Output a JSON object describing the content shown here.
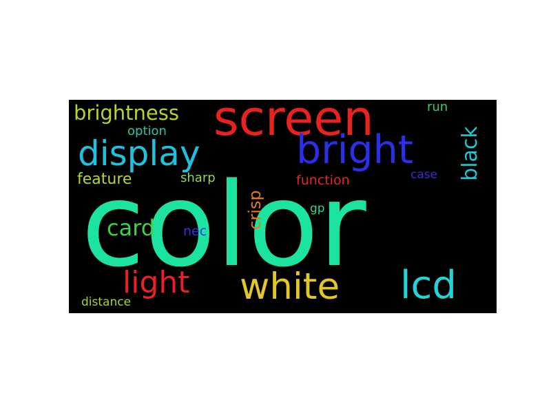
{
  "words": [
    {
      "text": "color",
      "color": "#1ce4a0"
    },
    {
      "text": "screen",
      "color": "#e8221f"
    },
    {
      "text": "bright",
      "color": "#2b2fe6"
    },
    {
      "text": "display",
      "color": "#1ec2dc"
    },
    {
      "text": "white",
      "color": "#e4c726"
    },
    {
      "text": "lcd",
      "color": "#23d4d6"
    },
    {
      "text": "light",
      "color": "#e52226"
    },
    {
      "text": "brightness",
      "color": "#b8d427"
    },
    {
      "text": "card",
      "color": "#3fd244"
    },
    {
      "text": "black",
      "color": "#1ec9d4"
    },
    {
      "text": "feature",
      "color": "#b4d92a"
    },
    {
      "text": "option",
      "color": "#27c8a6"
    },
    {
      "text": "sharp",
      "color": "#94d94a"
    },
    {
      "text": "crisp",
      "color": "#e07b24"
    },
    {
      "text": "function",
      "color": "#e32622"
    },
    {
      "text": "case",
      "color": "#4a26d6"
    },
    {
      "text": "run",
      "color": "#35d268"
    },
    {
      "text": "gp",
      "color": "#2ad98e"
    },
    {
      "text": "nec",
      "color": "#3a2fe0"
    },
    {
      "text": "distance",
      "color": "#a6d631"
    }
  ]
}
